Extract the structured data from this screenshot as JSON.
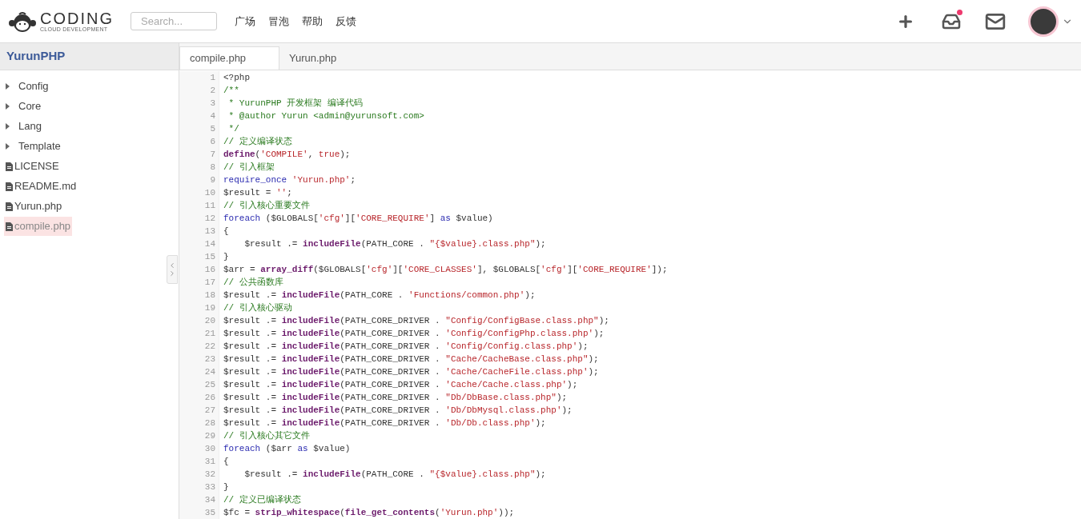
{
  "header": {
    "logo": {
      "name": "CODING",
      "tagline": "CLOUD DEVELOPMENT"
    },
    "search": {
      "placeholder": "Search..."
    },
    "nav": [
      "广场",
      "冒泡",
      "帮助",
      "反馈"
    ],
    "inbox_unread": true
  },
  "sidebar": {
    "project": "YurunPHP",
    "items": [
      {
        "kind": "folder",
        "label": "Config",
        "selected": false
      },
      {
        "kind": "folder",
        "label": "Core",
        "selected": false
      },
      {
        "kind": "folder",
        "label": "Lang",
        "selected": false
      },
      {
        "kind": "folder",
        "label": "Template",
        "selected": false
      },
      {
        "kind": "file",
        "label": "LICENSE",
        "selected": false
      },
      {
        "kind": "file",
        "label": "README.md",
        "selected": false
      },
      {
        "kind": "file",
        "label": "Yurun.php",
        "selected": false
      },
      {
        "kind": "file",
        "label": "compile.php",
        "selected": true
      }
    ]
  },
  "tabs": [
    {
      "label": "compile.php",
      "selected": true
    },
    {
      "label": "Yurun.php",
      "selected": false
    }
  ],
  "code": [
    {
      "number": "1",
      "tokens": [
        {
          "kind": "plain",
          "text": "<?php"
        }
      ]
    },
    {
      "number": "2",
      "tokens": [
        {
          "kind": "comment",
          "text": "/**"
        }
      ]
    },
    {
      "number": "3",
      "tokens": [
        {
          "kind": "comment",
          "text": " * YurunPHP 开发框架 编译代码"
        }
      ]
    },
    {
      "number": "4",
      "tokens": [
        {
          "kind": "comment",
          "text": " * @author Yurun <admin@yurunsoft.com>"
        }
      ]
    },
    {
      "number": "5",
      "tokens": [
        {
          "kind": "comment",
          "text": " */"
        }
      ]
    },
    {
      "number": "6",
      "tokens": [
        {
          "kind": "comment",
          "text": "// 定义编译状态"
        }
      ]
    },
    {
      "number": "7",
      "tokens": [
        {
          "kind": "function",
          "text": "define"
        },
        {
          "kind": "plain",
          "text": "("
        },
        {
          "kind": "string",
          "text": "'COMPILE'"
        },
        {
          "kind": "plain",
          "text": ", "
        },
        {
          "kind": "string",
          "text": "true"
        },
        {
          "kind": "plain",
          "text": ");"
        }
      ]
    },
    {
      "number": "8",
      "tokens": [
        {
          "kind": "comment",
          "text": "// 引入框架"
        }
      ]
    },
    {
      "number": "9",
      "tokens": [
        {
          "kind": "keyword",
          "text": "require_once "
        },
        {
          "kind": "string",
          "text": "'Yurun.php'"
        },
        {
          "kind": "plain",
          "text": ";"
        }
      ]
    },
    {
      "number": "10",
      "tokens": [
        {
          "kind": "plain",
          "text": "$result = "
        },
        {
          "kind": "string",
          "text": "''"
        },
        {
          "kind": "plain",
          "text": ";"
        }
      ]
    },
    {
      "number": "11",
      "tokens": [
        {
          "kind": "comment",
          "text": "// 引入核心重要文件"
        }
      ]
    },
    {
      "number": "12",
      "tokens": [
        {
          "kind": "keyword",
          "text": "foreach"
        },
        {
          "kind": "plain",
          "text": " ($GLOBALS["
        },
        {
          "kind": "string",
          "text": "'cfg'"
        },
        {
          "kind": "plain",
          "text": "]["
        },
        {
          "kind": "string",
          "text": "'CORE_REQUIRE'"
        },
        {
          "kind": "plain",
          "text": "] "
        },
        {
          "kind": "keyword",
          "text": "as"
        },
        {
          "kind": "plain",
          "text": " $value)"
        }
      ]
    },
    {
      "number": "13",
      "tokens": [
        {
          "kind": "plain",
          "text": "{"
        }
      ]
    },
    {
      "number": "14",
      "tokens": [
        {
          "kind": "plain",
          "text": "    $result .= "
        },
        {
          "kind": "function",
          "text": "includeFile"
        },
        {
          "kind": "plain",
          "text": "(PATH_CORE . "
        },
        {
          "kind": "string",
          "text": "\"{$value}.class.php\""
        },
        {
          "kind": "plain",
          "text": ");"
        }
      ]
    },
    {
      "number": "15",
      "tokens": [
        {
          "kind": "plain",
          "text": "}"
        }
      ]
    },
    {
      "number": "16",
      "tokens": [
        {
          "kind": "plain",
          "text": "$arr = "
        },
        {
          "kind": "function",
          "text": "array_diff"
        },
        {
          "kind": "plain",
          "text": "($GLOBALS["
        },
        {
          "kind": "string",
          "text": "'cfg'"
        },
        {
          "kind": "plain",
          "text": "]["
        },
        {
          "kind": "string",
          "text": "'CORE_CLASSES'"
        },
        {
          "kind": "plain",
          "text": "], $GLOBALS["
        },
        {
          "kind": "string",
          "text": "'cfg'"
        },
        {
          "kind": "plain",
          "text": "]["
        },
        {
          "kind": "string",
          "text": "'CORE_REQUIRE'"
        },
        {
          "kind": "plain",
          "text": "]);"
        }
      ]
    },
    {
      "number": "17",
      "tokens": [
        {
          "kind": "comment",
          "text": "// 公共函数库"
        }
      ]
    },
    {
      "number": "18",
      "tokens": [
        {
          "kind": "plain",
          "text": "$result .= "
        },
        {
          "kind": "function",
          "text": "includeFile"
        },
        {
          "kind": "plain",
          "text": "(PATH_CORE . "
        },
        {
          "kind": "string",
          "text": "'Functions/common.php'"
        },
        {
          "kind": "plain",
          "text": ");"
        }
      ]
    },
    {
      "number": "19",
      "tokens": [
        {
          "kind": "comment",
          "text": "// 引入核心驱动"
        }
      ]
    },
    {
      "number": "20",
      "tokens": [
        {
          "kind": "plain",
          "text": "$result .= "
        },
        {
          "kind": "function",
          "text": "includeFile"
        },
        {
          "kind": "plain",
          "text": "(PATH_CORE_DRIVER . "
        },
        {
          "kind": "string",
          "text": "\"Config/ConfigBase.class.php\""
        },
        {
          "kind": "plain",
          "text": ");"
        }
      ]
    },
    {
      "number": "21",
      "tokens": [
        {
          "kind": "plain",
          "text": "$result .= "
        },
        {
          "kind": "function",
          "text": "includeFile"
        },
        {
          "kind": "plain",
          "text": "(PATH_CORE_DRIVER . "
        },
        {
          "kind": "string",
          "text": "'Config/ConfigPhp.class.php'"
        },
        {
          "kind": "plain",
          "text": ");"
        }
      ]
    },
    {
      "number": "22",
      "tokens": [
        {
          "kind": "plain",
          "text": "$result .= "
        },
        {
          "kind": "function",
          "text": "includeFile"
        },
        {
          "kind": "plain",
          "text": "(PATH_CORE_DRIVER . "
        },
        {
          "kind": "string",
          "text": "'Config/Config.class.php'"
        },
        {
          "kind": "plain",
          "text": ");"
        }
      ]
    },
    {
      "number": "23",
      "tokens": [
        {
          "kind": "plain",
          "text": "$result .= "
        },
        {
          "kind": "function",
          "text": "includeFile"
        },
        {
          "kind": "plain",
          "text": "(PATH_CORE_DRIVER . "
        },
        {
          "kind": "string",
          "text": "\"Cache/CacheBase.class.php\""
        },
        {
          "kind": "plain",
          "text": ");"
        }
      ]
    },
    {
      "number": "24",
      "tokens": [
        {
          "kind": "plain",
          "text": "$result .= "
        },
        {
          "kind": "function",
          "text": "includeFile"
        },
        {
          "kind": "plain",
          "text": "(PATH_CORE_DRIVER . "
        },
        {
          "kind": "string",
          "text": "'Cache/CacheFile.class.php'"
        },
        {
          "kind": "plain",
          "text": ");"
        }
      ]
    },
    {
      "number": "25",
      "tokens": [
        {
          "kind": "plain",
          "text": "$result .= "
        },
        {
          "kind": "function",
          "text": "includeFile"
        },
        {
          "kind": "plain",
          "text": "(PATH_CORE_DRIVER . "
        },
        {
          "kind": "string",
          "text": "'Cache/Cache.class.php'"
        },
        {
          "kind": "plain",
          "text": ");"
        }
      ]
    },
    {
      "number": "26",
      "tokens": [
        {
          "kind": "plain",
          "text": "$result .= "
        },
        {
          "kind": "function",
          "text": "includeFile"
        },
        {
          "kind": "plain",
          "text": "(PATH_CORE_DRIVER . "
        },
        {
          "kind": "string",
          "text": "\"Db/DbBase.class.php\""
        },
        {
          "kind": "plain",
          "text": ");"
        }
      ]
    },
    {
      "number": "27",
      "tokens": [
        {
          "kind": "plain",
          "text": "$result .= "
        },
        {
          "kind": "function",
          "text": "includeFile"
        },
        {
          "kind": "plain",
          "text": "(PATH_CORE_DRIVER . "
        },
        {
          "kind": "string",
          "text": "'Db/DbMysql.class.php'"
        },
        {
          "kind": "plain",
          "text": ");"
        }
      ]
    },
    {
      "number": "28",
      "tokens": [
        {
          "kind": "plain",
          "text": "$result .= "
        },
        {
          "kind": "function",
          "text": "includeFile"
        },
        {
          "kind": "plain",
          "text": "(PATH_CORE_DRIVER . "
        },
        {
          "kind": "string",
          "text": "'Db/Db.class.php'"
        },
        {
          "kind": "plain",
          "text": ");"
        }
      ]
    },
    {
      "number": "29",
      "tokens": [
        {
          "kind": "comment",
          "text": "// 引入核心其它文件"
        }
      ]
    },
    {
      "number": "30",
      "tokens": [
        {
          "kind": "keyword",
          "text": "foreach"
        },
        {
          "kind": "plain",
          "text": " ($arr "
        },
        {
          "kind": "keyword",
          "text": "as"
        },
        {
          "kind": "plain",
          "text": " $value)"
        }
      ]
    },
    {
      "number": "31",
      "tokens": [
        {
          "kind": "plain",
          "text": "{"
        }
      ]
    },
    {
      "number": "32",
      "tokens": [
        {
          "kind": "plain",
          "text": "    $result .= "
        },
        {
          "kind": "function",
          "text": "includeFile"
        },
        {
          "kind": "plain",
          "text": "(PATH_CORE . "
        },
        {
          "kind": "string",
          "text": "\"{$value}.class.php\""
        },
        {
          "kind": "plain",
          "text": ");"
        }
      ]
    },
    {
      "number": "33",
      "tokens": [
        {
          "kind": "plain",
          "text": "}"
        }
      ]
    },
    {
      "number": "34",
      "tokens": [
        {
          "kind": "comment",
          "text": "// 定义已编译状态"
        }
      ]
    },
    {
      "number": "35",
      "tokens": [
        {
          "kind": "plain",
          "text": "$fc = "
        },
        {
          "kind": "function",
          "text": "strip_whitespace"
        },
        {
          "kind": "plain",
          "text": "("
        },
        {
          "kind": "function",
          "text": "file_get_contents"
        },
        {
          "kind": "plain",
          "text": "("
        },
        {
          "kind": "string",
          "text": "'Yurun.php'"
        },
        {
          "kind": "plain",
          "text": "));"
        }
      ]
    }
  ]
}
